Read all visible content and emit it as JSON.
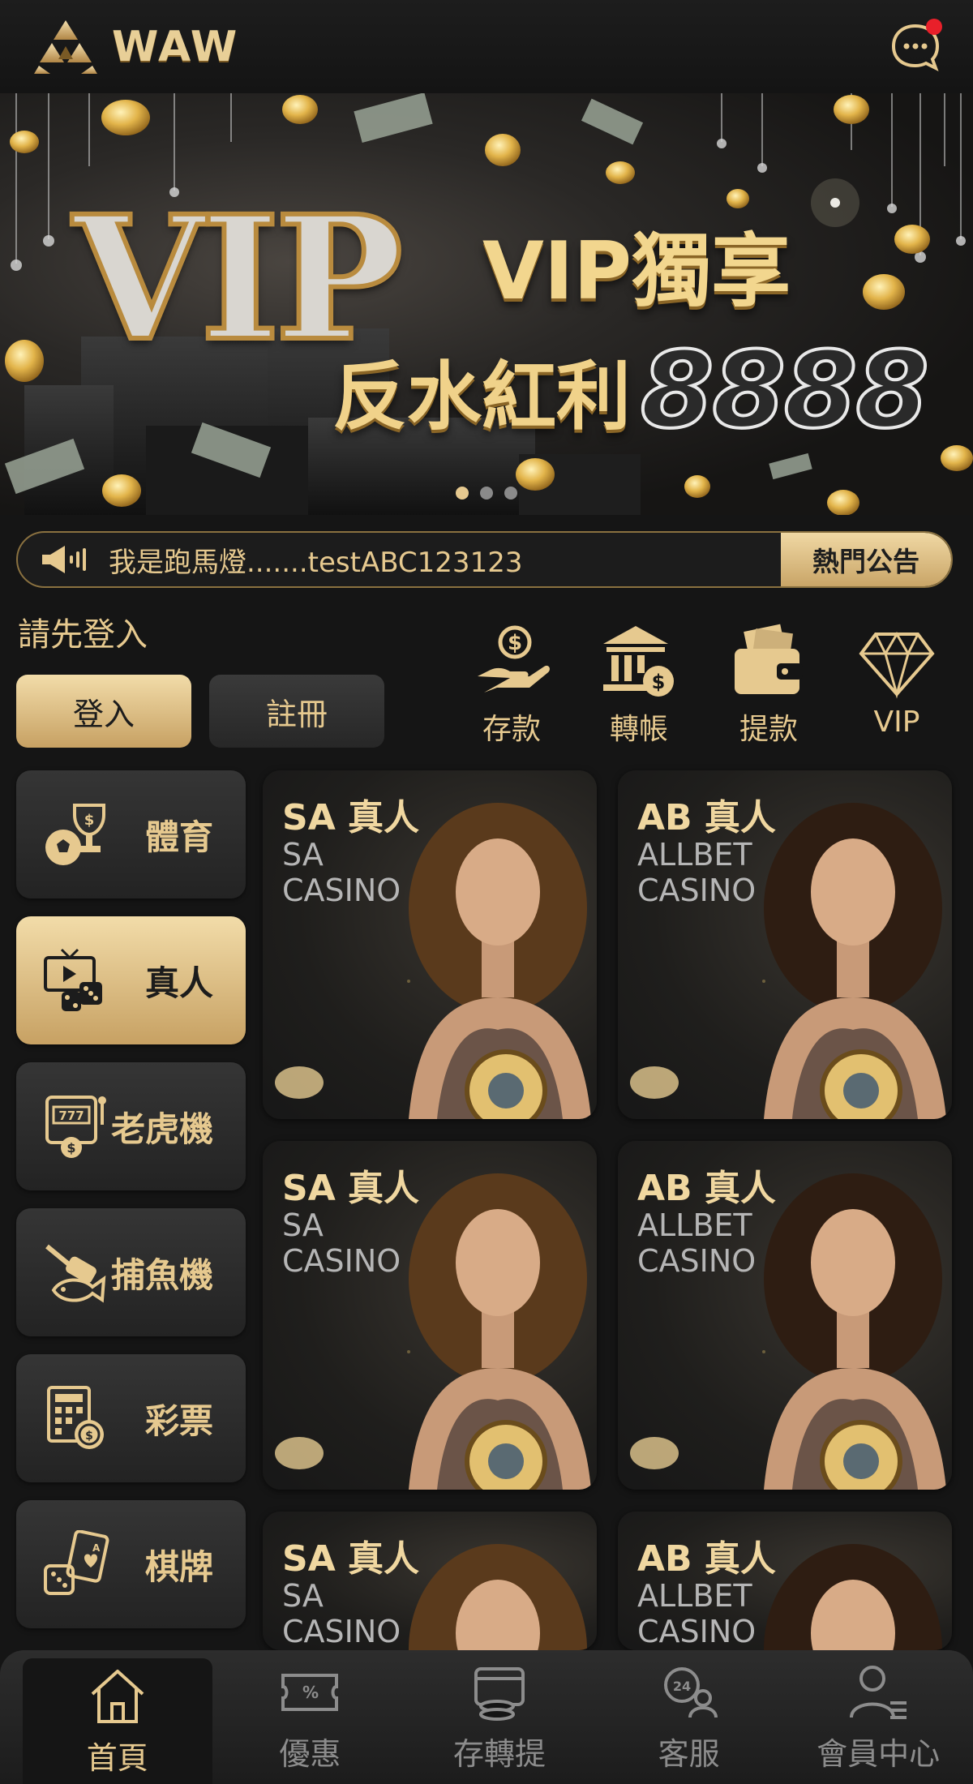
{
  "header": {
    "logo_text": "WAW",
    "chat_icon": "chat-bubble-icon",
    "has_notification": true
  },
  "banner": {
    "big_text": "VIP",
    "title": "VIP獨享",
    "subtitle": "反水紅利",
    "amount": "8888",
    "pages": 3,
    "active_page": 1
  },
  "marquee": {
    "icon": "speaker-icon",
    "text": "我是跑馬燈.......testABC123123",
    "button_label": "熱門公告"
  },
  "login": {
    "prompt": "請先登入",
    "login_label": "登入",
    "register_label": "註冊"
  },
  "quick_actions": [
    {
      "label": "存款",
      "icon": "deposit-icon"
    },
    {
      "label": "轉帳",
      "icon": "bank-transfer-icon"
    },
    {
      "label": "提款",
      "icon": "wallet-withdraw-icon"
    },
    {
      "label": "VIP",
      "icon": "diamond-icon"
    }
  ],
  "categories": [
    {
      "label": "體育",
      "icon": "sports-trophy-icon",
      "active": false
    },
    {
      "label": "真人",
      "icon": "live-casino-icon",
      "active": true
    },
    {
      "label": "老虎機",
      "icon": "slot-machine-icon",
      "active": false
    },
    {
      "label": "捕魚機",
      "icon": "fishing-icon",
      "active": false
    },
    {
      "label": "彩票",
      "icon": "lottery-icon",
      "active": false
    },
    {
      "label": "棋牌",
      "icon": "cards-dice-icon",
      "active": false
    }
  ],
  "games": [
    {
      "title": "SA 真人",
      "subtitle": "SA CASINO"
    },
    {
      "title": "AB 真人",
      "subtitle": "ALLBET CASINO"
    },
    {
      "title": "SA 真人",
      "subtitle": "SA CASINO"
    },
    {
      "title": "AB 真人",
      "subtitle": "ALLBET CASINO"
    },
    {
      "title": "SA 真人",
      "subtitle": "SA CASINO"
    },
    {
      "title": "AB 真人",
      "subtitle": "ALLBET CASINO"
    }
  ],
  "bottom_nav": [
    {
      "label": "首頁",
      "icon": "home-icon",
      "active": true
    },
    {
      "label": "優惠",
      "icon": "coupon-icon",
      "active": false
    },
    {
      "label": "存轉提",
      "icon": "wallet-coins-icon",
      "active": false
    },
    {
      "label": "客服",
      "icon": "customer-service-icon",
      "active": false
    },
    {
      "label": "會員中心",
      "icon": "member-icon",
      "active": false
    }
  ],
  "colors": {
    "background": "#151515",
    "gold": "#e6c98f",
    "gold_button": "#d9b67a",
    "dark_button": "#2e2e2e",
    "notification": "#e8202a"
  }
}
